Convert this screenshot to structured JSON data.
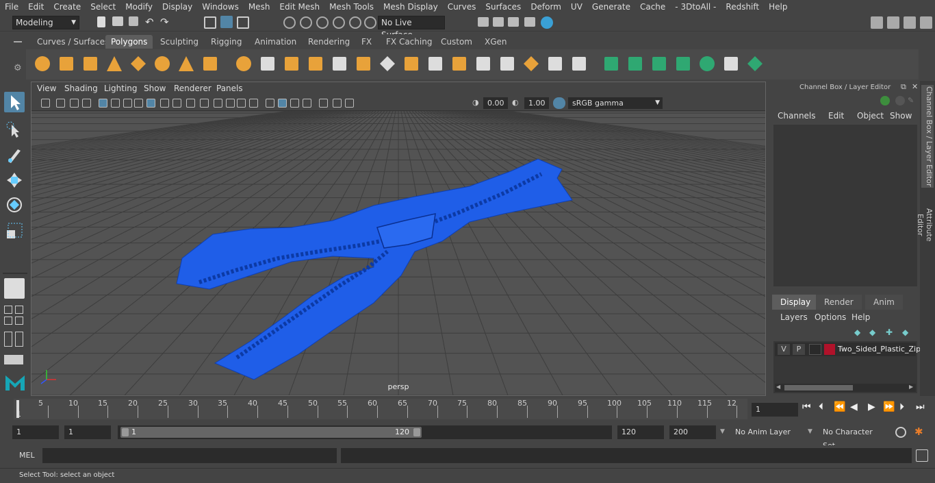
{
  "menu": [
    "File",
    "Edit",
    "Create",
    "Select",
    "Modify",
    "Display",
    "Windows",
    "Mesh",
    "Edit Mesh",
    "Mesh Tools",
    "Mesh Display",
    "Curves",
    "Surfaces",
    "Deform",
    "UV",
    "Generate",
    "Cache",
    "- 3DtoAll -",
    "Redshift",
    "Help"
  ],
  "status": {
    "workspace": "Modeling",
    "live_surface": "No Live Surface"
  },
  "shelf_tabs": [
    "Curves / Surfaces",
    "Polygons",
    "Sculpting",
    "Rigging",
    "Animation",
    "Rendering",
    "FX",
    "FX Caching",
    "Custom",
    "XGen"
  ],
  "active_shelf_tab": "Polygons",
  "viewport": {
    "menu": [
      "View",
      "Shading",
      "Lighting",
      "Show",
      "Renderer",
      "Panels"
    ],
    "exposure": "0.00",
    "gamma": "1.00",
    "color_space": "sRGB gamma",
    "camera_label": "persp"
  },
  "channel_box": {
    "title": "Channel Box / Layer Editor",
    "menu": [
      "Channels",
      "Edit",
      "Object",
      "Show"
    ],
    "tabs": [
      "Display",
      "Render",
      "Anim"
    ],
    "layer_menu": [
      "Layers",
      "Options",
      "Help"
    ],
    "layer": {
      "v": "V",
      "p": "P",
      "name": "Two_Sided_Plastic_Zip",
      "color": "#b0122a"
    }
  },
  "side_tabs": [
    "Channel Box / Layer Editor",
    "Attribute Editor"
  ],
  "timeline": {
    "ticks": [
      "5",
      "10",
      "15",
      "20",
      "25",
      "30",
      "35",
      "40",
      "45",
      "50",
      "55",
      "60",
      "65",
      "70",
      "75",
      "80",
      "85",
      "90",
      "95",
      "100",
      "105",
      "110",
      "115",
      "12"
    ],
    "start_marker": "1",
    "current_frame": "1"
  },
  "range": {
    "start": "1",
    "playback_start": "1",
    "slider_start": "1",
    "slider_end": "120",
    "playback_end": "120",
    "end": "200",
    "anim_layer": "No Anim Layer",
    "character_set": "No Character Set"
  },
  "command": {
    "lang": "MEL"
  },
  "help_line": "Select Tool: select an object",
  "colors": {
    "zipper": "#1f5ee8",
    "accent": "#5285a6",
    "shelf_green": "#2fa872"
  }
}
